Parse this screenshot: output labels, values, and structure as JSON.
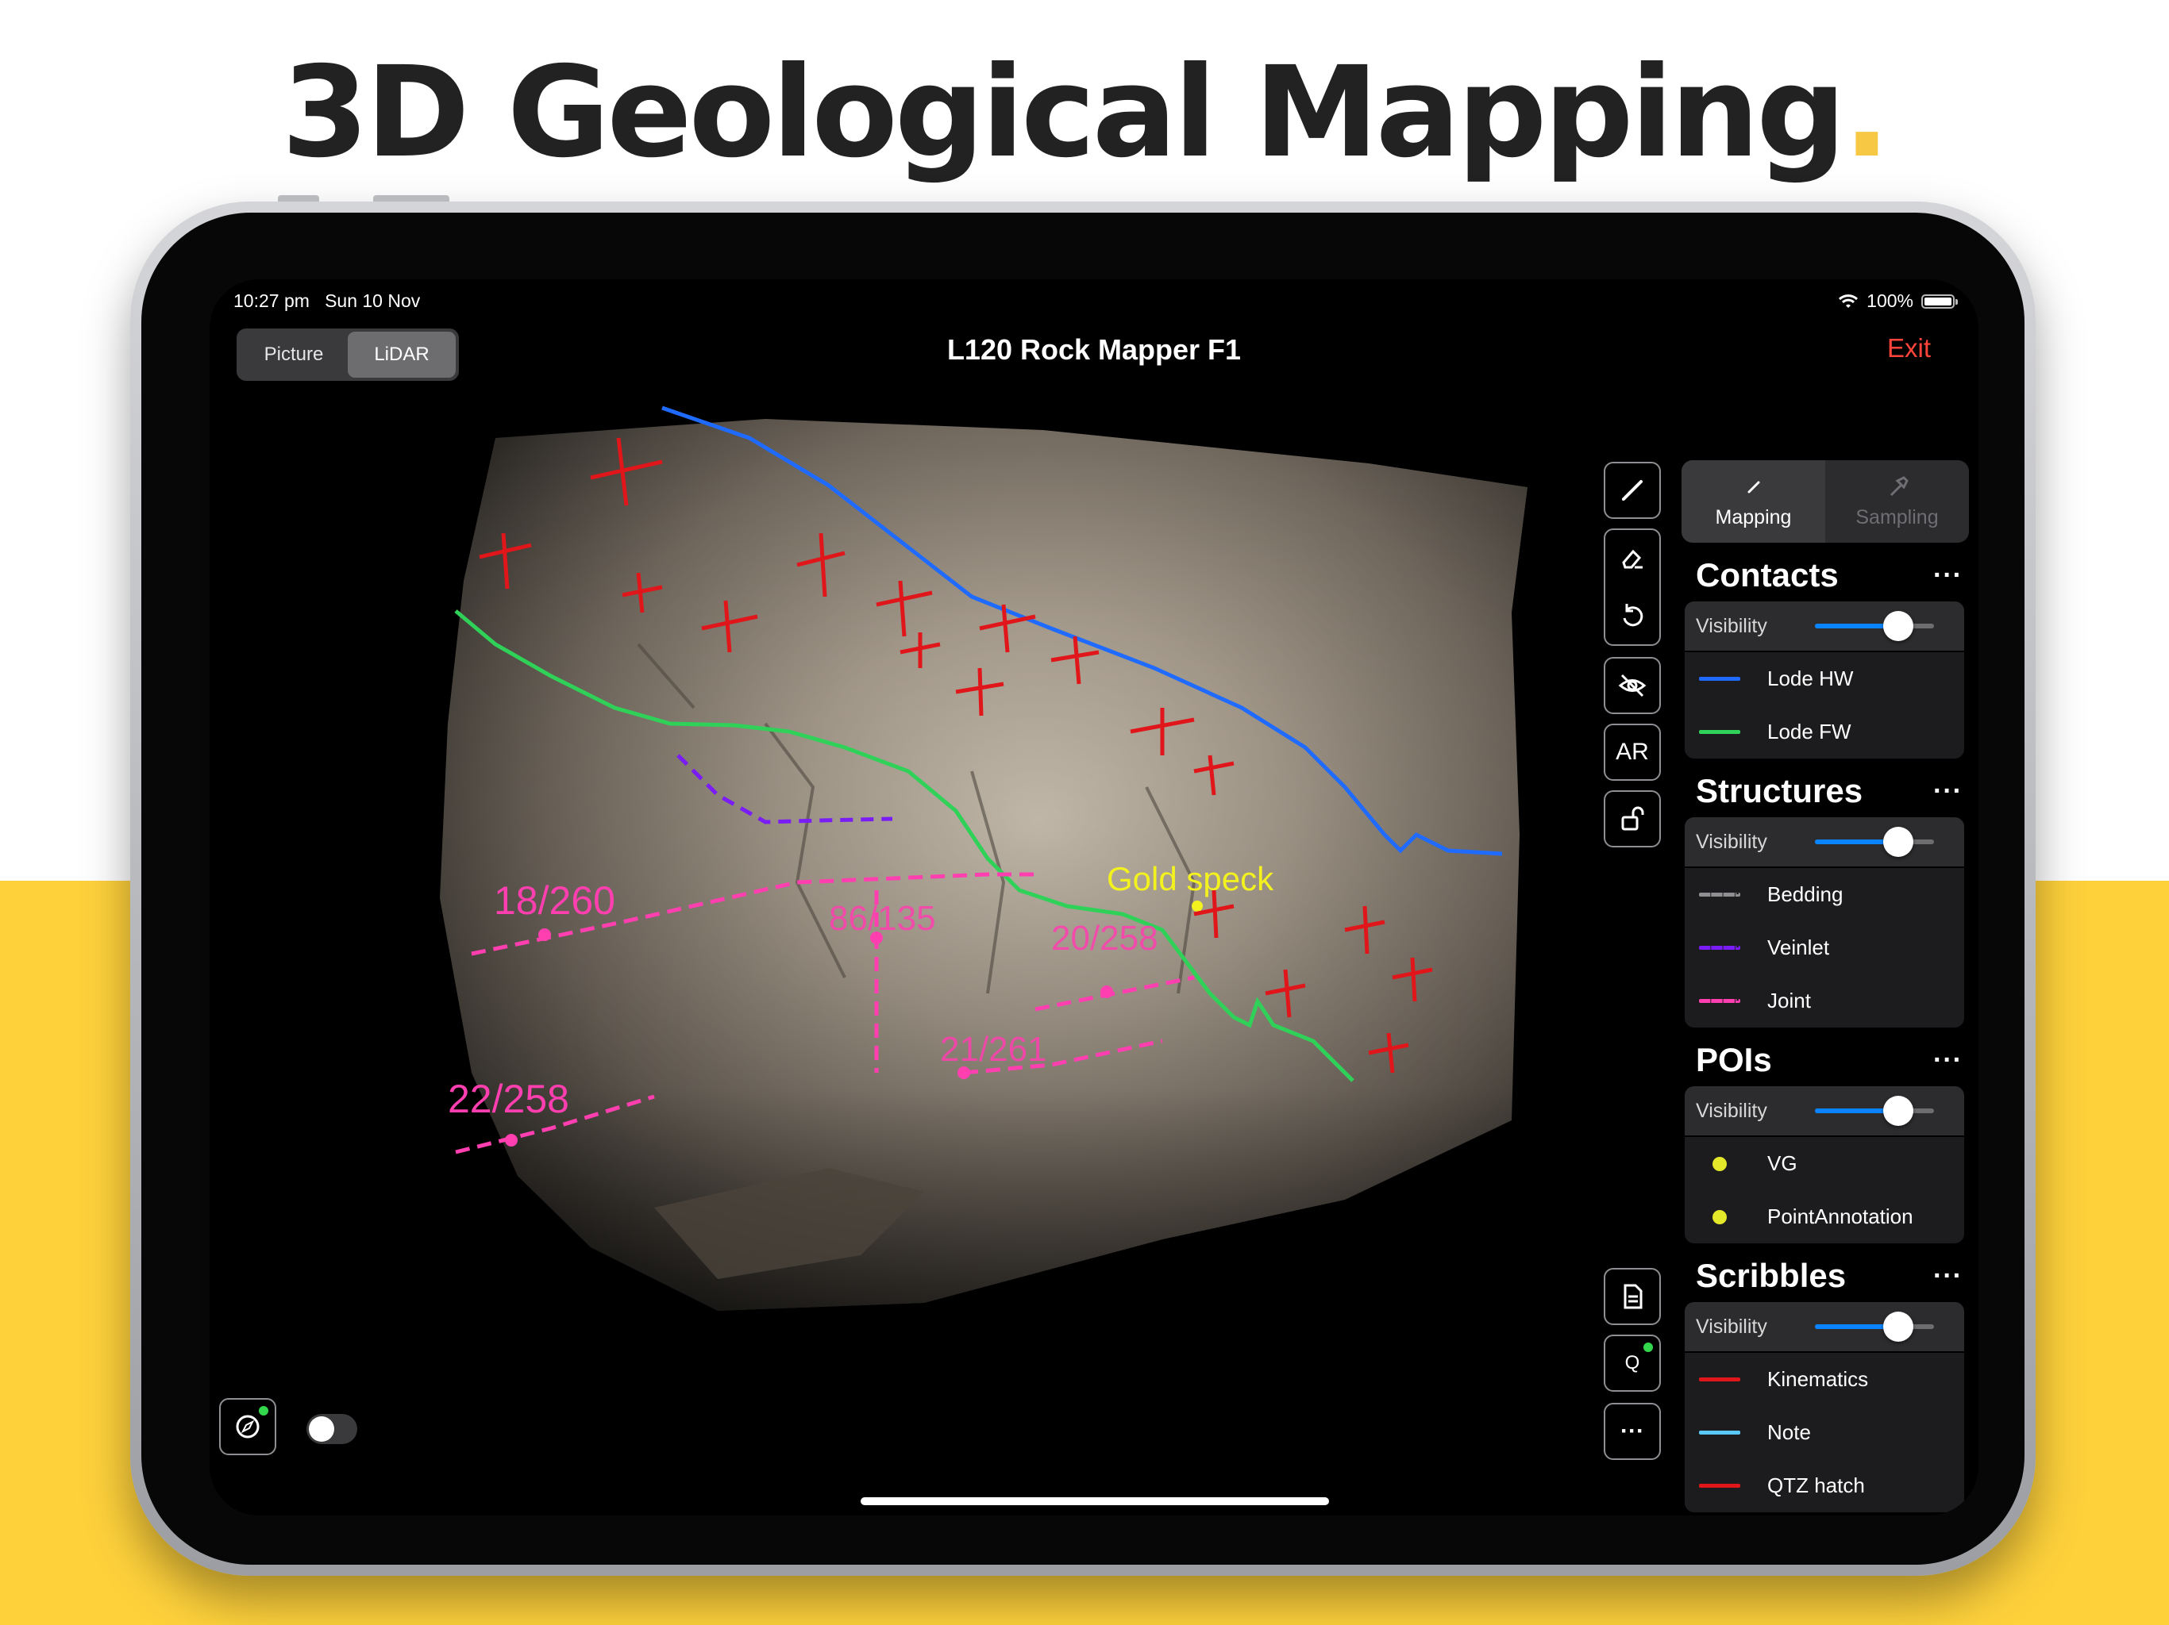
{
  "headline": {
    "text": "3D Geological Mapping",
    "dot": "."
  },
  "status_bar": {
    "time": "10:27 pm   Sun 10 Nov",
    "battery": "100%",
    "battery_level": 1.0
  },
  "view_toggle": {
    "options": [
      "Picture",
      "LiDAR"
    ],
    "selected": "LiDAR"
  },
  "title": "L120 Rock Mapper F1",
  "exit_label": "Exit",
  "tools": {
    "draw": "pencil-line-icon",
    "erase": "eraser-icon",
    "undo": "undo-icon",
    "hide": "eye-slash-icon",
    "ar": "AR",
    "lock": "unlock-icon",
    "report": "document-icon",
    "q": "Q",
    "more": "···"
  },
  "modes": [
    {
      "label": "Mapping",
      "icon": "pencil-icon",
      "active": true
    },
    {
      "label": "Sampling",
      "icon": "hammer-icon",
      "active": false
    }
  ],
  "sections": [
    {
      "title": "Contacts",
      "visibility_label": "Visibility",
      "visibility": 0.7,
      "items": [
        {
          "label": "Lode HW",
          "color": "#1f6bff",
          "style": "solid"
        },
        {
          "label": "Lode FW",
          "color": "#30d158",
          "style": "solid"
        }
      ]
    },
    {
      "title": "Structures",
      "visibility_label": "Visibility",
      "visibility": 0.7,
      "items": [
        {
          "label": "Bedding",
          "color": "#8e8e93",
          "style": "dashed"
        },
        {
          "label": "Veinlet",
          "color": "#7a1cf5",
          "style": "dashed"
        },
        {
          "label": "Joint",
          "color": "#ff3fb0",
          "style": "dashed"
        }
      ]
    },
    {
      "title": "POIs",
      "visibility_label": "Visibility",
      "visibility": 0.7,
      "items": [
        {
          "label": "VG",
          "color": "#e4e82a",
          "style": "dot"
        },
        {
          "label": "PointAnnotation",
          "color": "#e4e82a",
          "style": "dot"
        }
      ]
    },
    {
      "title": "Scribbles",
      "visibility_label": "Visibility",
      "visibility": 0.7,
      "items": [
        {
          "label": "Kinematics",
          "color": "#e0161a",
          "style": "solid"
        },
        {
          "label": "Note",
          "color": "#5ac8fa",
          "style": "solid"
        },
        {
          "label": "QTZ hatch",
          "color": "#e0161a",
          "style": "solid"
        }
      ]
    }
  ],
  "section_more": "···",
  "annotations": {
    "labels": [
      "18/260",
      "86/135",
      "20/258",
      "21/261",
      "22/258"
    ],
    "poi_label": "Gold speck"
  },
  "bottom": {
    "compass_icon": "compass-icon",
    "toggle_on": false
  }
}
